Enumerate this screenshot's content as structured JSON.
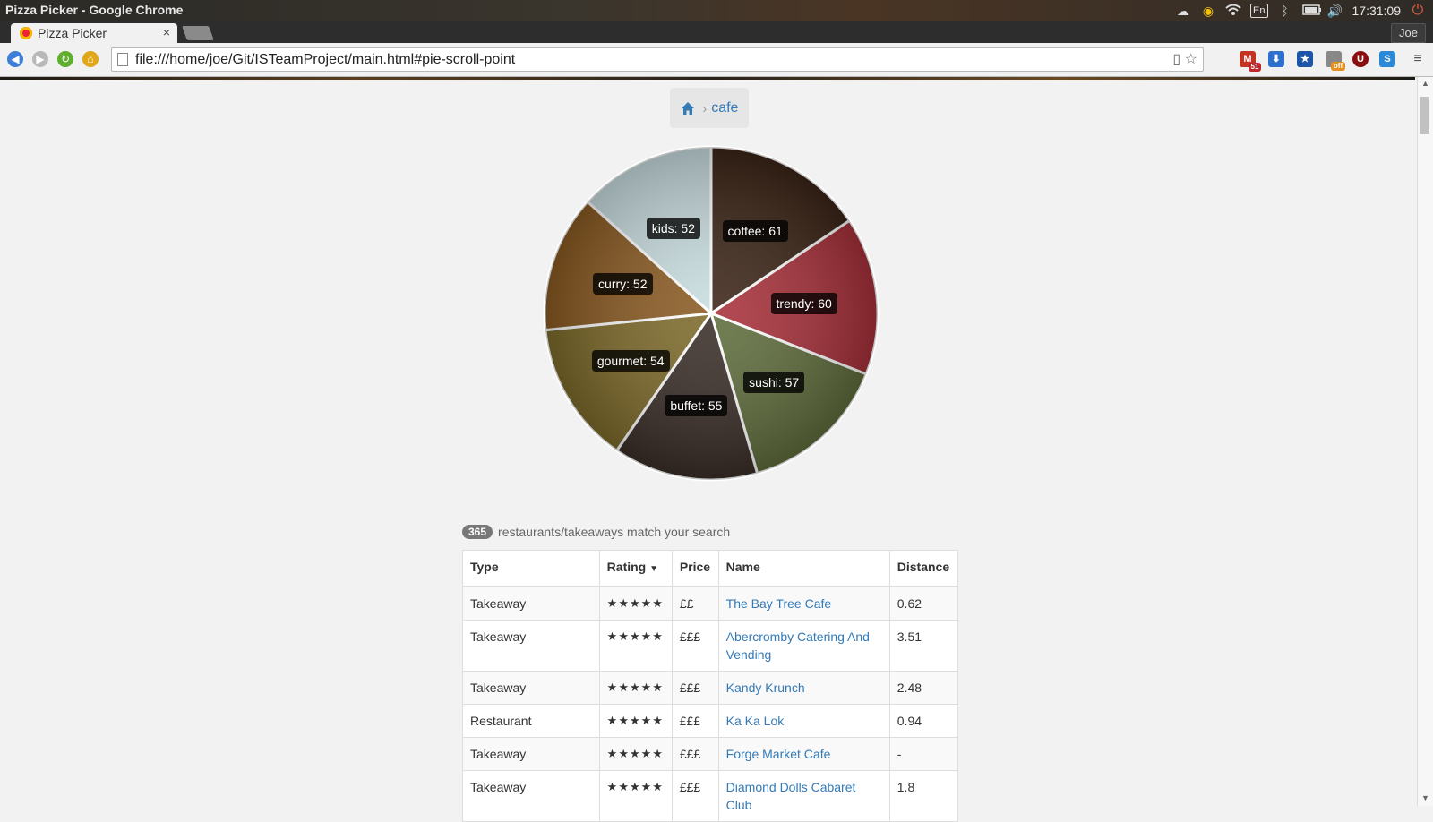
{
  "os": {
    "title": "Pizza Picker - Google Chrome",
    "lang": "En",
    "clock": "17:31:09"
  },
  "browser": {
    "tab_title": "Pizza Picker",
    "tab_close": "×",
    "profile": "Joe",
    "url": "file:///home/joe/Git/ISTeamProject/main.html#pie-scroll-point",
    "gmail_count": "51",
    "ext_off": "off",
    "ext_u": "U"
  },
  "breadcrumb": {
    "current": "cafe"
  },
  "pie": {
    "slices": [
      {
        "label": "coffee: 61",
        "value": 61,
        "color": "#3b2416"
      },
      {
        "label": "trendy: 60",
        "value": 60,
        "color": "#a8303a"
      },
      {
        "label": "sushi: 57",
        "value": 57,
        "color": "#5f6d3c"
      },
      {
        "label": "buffet: 55",
        "value": 55,
        "color": "#3a2e28"
      },
      {
        "label": "gourmet: 54",
        "value": 54,
        "color": "#7d6a2a"
      },
      {
        "label": "curry: 52",
        "value": 52,
        "color": "#8a5a22"
      },
      {
        "label": "kids: 52",
        "value": 52,
        "color": "#c9dde0"
      }
    ]
  },
  "results": {
    "count": "365",
    "text": "restaurants/takeaways match your search",
    "headers": {
      "type": "Type",
      "rating": "Rating",
      "rating_sort": "▼",
      "price": "Price",
      "name": "Name",
      "distance": "Distance"
    },
    "rows": [
      {
        "type": "Takeaway",
        "rating": "★★★★★",
        "price": "££",
        "name": "The Bay Tree Cafe",
        "distance": "0.62"
      },
      {
        "type": "Takeaway",
        "rating": "★★★★★",
        "price": "£££",
        "name": "Abercromby Catering And Vending",
        "distance": "3.51"
      },
      {
        "type": "Takeaway",
        "rating": "★★★★★",
        "price": "£££",
        "name": "Kandy Krunch",
        "distance": "2.48"
      },
      {
        "type": "Restaurant",
        "rating": "★★★★★",
        "price": "£££",
        "name": "Ka Ka Lok",
        "distance": "0.94"
      },
      {
        "type": "Takeaway",
        "rating": "★★★★★",
        "price": "£££",
        "name": "Forge Market Cafe",
        "distance": "-"
      },
      {
        "type": "Takeaway",
        "rating": "★★★★★",
        "price": "£££",
        "name": "Diamond Dolls Cabaret Club",
        "distance": "1.8"
      }
    ]
  }
}
